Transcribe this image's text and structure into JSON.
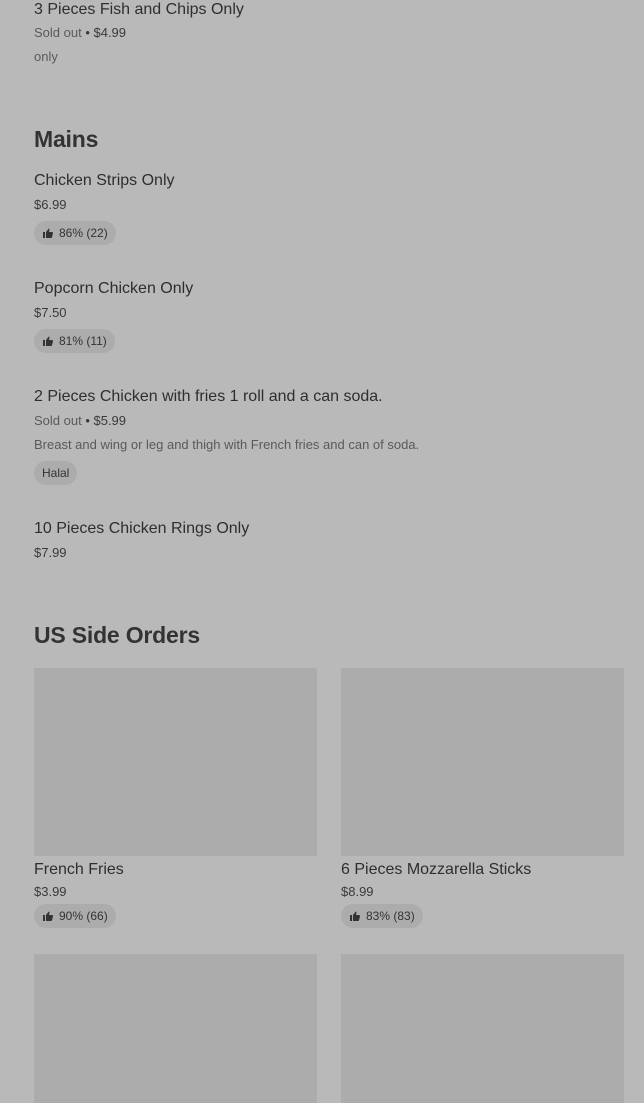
{
  "top_item": {
    "name": "3 Pieces Fish and Chips Only",
    "status": "Sold out",
    "separator": " • ",
    "price": "$4.99",
    "description": "only"
  },
  "mains": {
    "title": "Mains",
    "items": [
      {
        "name": "Chicken Strips Only",
        "price": "$6.99",
        "rating": "86% (22)"
      },
      {
        "name": "Popcorn Chicken Only",
        "price": "$7.50",
        "rating": "81% (11)"
      },
      {
        "name": "2 Pieces Chicken with fries 1 roll and a can soda.",
        "status": "Sold out",
        "separator": " • ",
        "price": "$5.99",
        "description": "Breast and wing or leg and thigh with French fries and can of soda.",
        "tag": "Halal"
      },
      {
        "name": "10 Pieces Chicken Rings Only",
        "price": "$7.99"
      }
    ]
  },
  "side_orders": {
    "title": "US Side Orders",
    "cards": [
      {
        "name": "French Fries",
        "price": "$3.99",
        "rating": "90% (66)"
      },
      {
        "name": "6 Pieces Mozzarella Sticks",
        "price": "$8.99",
        "rating": "83% (83)"
      }
    ]
  },
  "icons": {
    "rating": "thumbs-up-icon"
  }
}
